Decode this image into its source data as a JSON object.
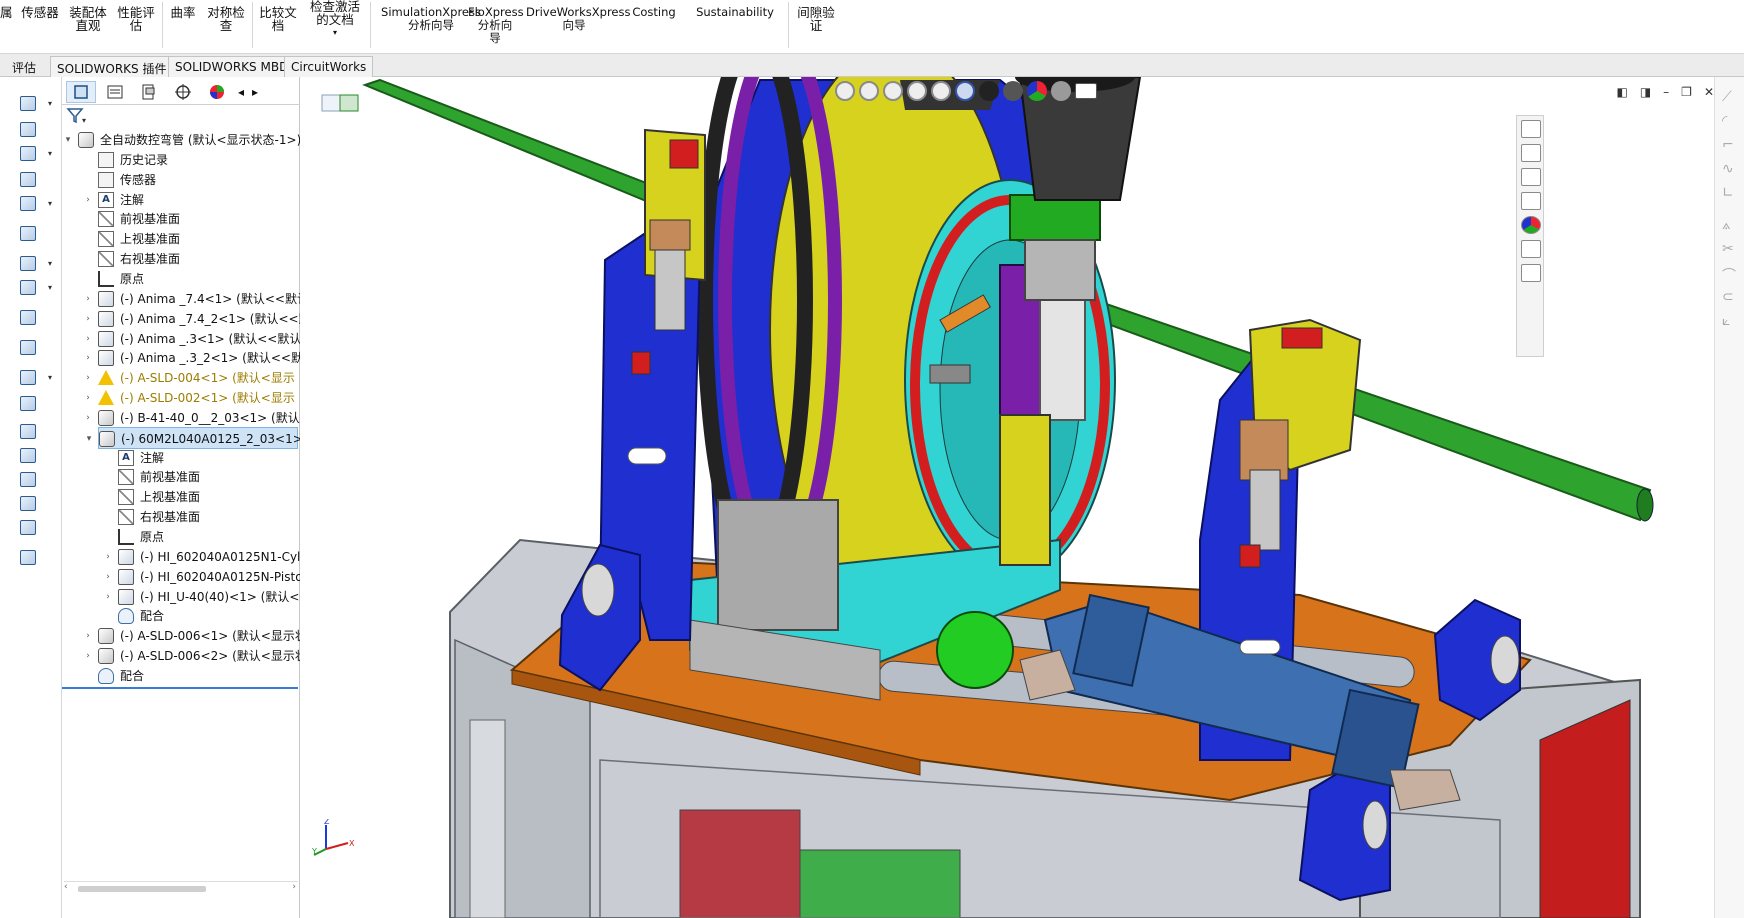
{
  "ribbon": {
    "buttons": [
      {
        "id": "sensor",
        "label": "传感器"
      },
      {
        "id": "asm-visual",
        "label": "装配体\n直观"
      },
      {
        "id": "perf-eval",
        "label": "性能评\n估"
      },
      {
        "id": "curvature",
        "label": "曲率"
      },
      {
        "id": "symmetry",
        "label": "对称检\n查"
      },
      {
        "id": "compare",
        "label": "比较文\n档"
      },
      {
        "id": "check-active",
        "label": "检查激活\n的文档"
      },
      {
        "id": "simxpress",
        "label": "SimulationXpress\n分析向导"
      },
      {
        "id": "floxpress",
        "label": "FloXpress\n分析向\n导"
      },
      {
        "id": "driveworks",
        "label": "DriveWorksXpress\n向导"
      },
      {
        "id": "costing",
        "label": "Costing"
      },
      {
        "id": "sustainability",
        "label": "Sustainability"
      },
      {
        "id": "clearance",
        "label": "间隙验\n证"
      }
    ],
    "cut_left_label": "属"
  },
  "tabs": [
    "评估",
    "SOLIDWORKS 插件",
    "SOLIDWORKS MBD",
    "CircuitWorks"
  ],
  "tree": [
    {
      "label": "全自动数控弯管  (默认<显示状态-1>)",
      "icon": "assembly-icon",
      "indent": 0,
      "arrow": "▾"
    },
    {
      "label": "历史记录",
      "icon": "history-icon",
      "indent": 1,
      "arrow": ""
    },
    {
      "label": "传感器",
      "icon": "sensor-icon",
      "indent": 1,
      "arrow": ""
    },
    {
      "label": "注解",
      "icon": "annotation-icon",
      "indent": 1,
      "arrow": "›"
    },
    {
      "label": "前视基准面",
      "icon": "plane-icon",
      "indent": 1,
      "arrow": ""
    },
    {
      "label": "上视基准面",
      "icon": "plane-icon",
      "indent": 1,
      "arrow": ""
    },
    {
      "label": "右视基准面",
      "icon": "plane-icon",
      "indent": 1,
      "arrow": ""
    },
    {
      "label": "原点",
      "icon": "origin-icon",
      "indent": 1,
      "arrow": ""
    },
    {
      "label": "(-) Anima _7.4<1> (默认<<默认>_",
      "icon": "part-icon",
      "indent": 1,
      "arrow": "›"
    },
    {
      "label": "(-) Anima _7.4_2<1> (默认<<默认",
      "icon": "part-icon",
      "indent": 1,
      "arrow": "›"
    },
    {
      "label": "(-) Anima _.3<1> (默认<<默认>_",
      "icon": "part-icon",
      "indent": 1,
      "arrow": "›"
    },
    {
      "label": "(-) Anima _.3_2<1> (默认<<默认",
      "icon": "part-icon",
      "indent": 1,
      "arrow": "›"
    },
    {
      "label": "(-) A-SLD-004<1> (默认<显示",
      "icon": "warning-icon",
      "indent": 1,
      "arrow": "›",
      "warn": true
    },
    {
      "label": "(-) A-SLD-002<1> (默认<显示",
      "icon": "warning-icon",
      "indent": 1,
      "arrow": "›",
      "warn": true
    },
    {
      "label": "(-) B-41-40_0__2_03<1> (默认<显",
      "icon": "assembly-icon",
      "indent": 1,
      "arrow": "›"
    },
    {
      "label": "(-) 60M2L040A0125_2_03<1> (默",
      "icon": "assembly-icon",
      "indent": 1,
      "arrow": "▾",
      "selected": true
    },
    {
      "label": "注解",
      "icon": "annotation-icon",
      "indent": 2,
      "arrow": ""
    },
    {
      "label": "前视基准面",
      "icon": "plane-icon",
      "indent": 2,
      "arrow": ""
    },
    {
      "label": "上视基准面",
      "icon": "plane-icon",
      "indent": 2,
      "arrow": ""
    },
    {
      "label": "右视基准面",
      "icon": "plane-icon",
      "indent": 2,
      "arrow": ""
    },
    {
      "label": "原点",
      "icon": "origin-icon",
      "indent": 2,
      "arrow": ""
    },
    {
      "label": "(-) HI_602040A0125N1-Cylin",
      "icon": "part-icon",
      "indent": 2,
      "arrow": "›"
    },
    {
      "label": "(-) HI_602040A0125N-Piston",
      "icon": "part-icon",
      "indent": 2,
      "arrow": "›"
    },
    {
      "label": "(-) HI_U-40(40)<1> (默认<<默",
      "icon": "part-icon",
      "indent": 2,
      "arrow": "›"
    },
    {
      "label": "配合",
      "icon": "mate-icon",
      "indent": 2,
      "arrow": ""
    },
    {
      "label": "(-) A-SLD-006<1> (默认<显示状态",
      "icon": "assembly-icon",
      "indent": 1,
      "arrow": "›"
    },
    {
      "label": "(-) A-SLD-006<2> (默认<显示状态",
      "icon": "assembly-icon",
      "indent": 1,
      "arrow": "›"
    },
    {
      "label": "配合",
      "icon": "mate-icon",
      "indent": 1,
      "arrow": ""
    }
  ],
  "colors": {
    "pipe": "#2ea32e",
    "frame_blue": "#1f2fd0",
    "wheel_yellow": "#d6d21e",
    "base_orange": "#d7731a",
    "cyan": "#31d3d3",
    "cabinet": "#c9cdd3",
    "red": "#d21e1e"
  }
}
